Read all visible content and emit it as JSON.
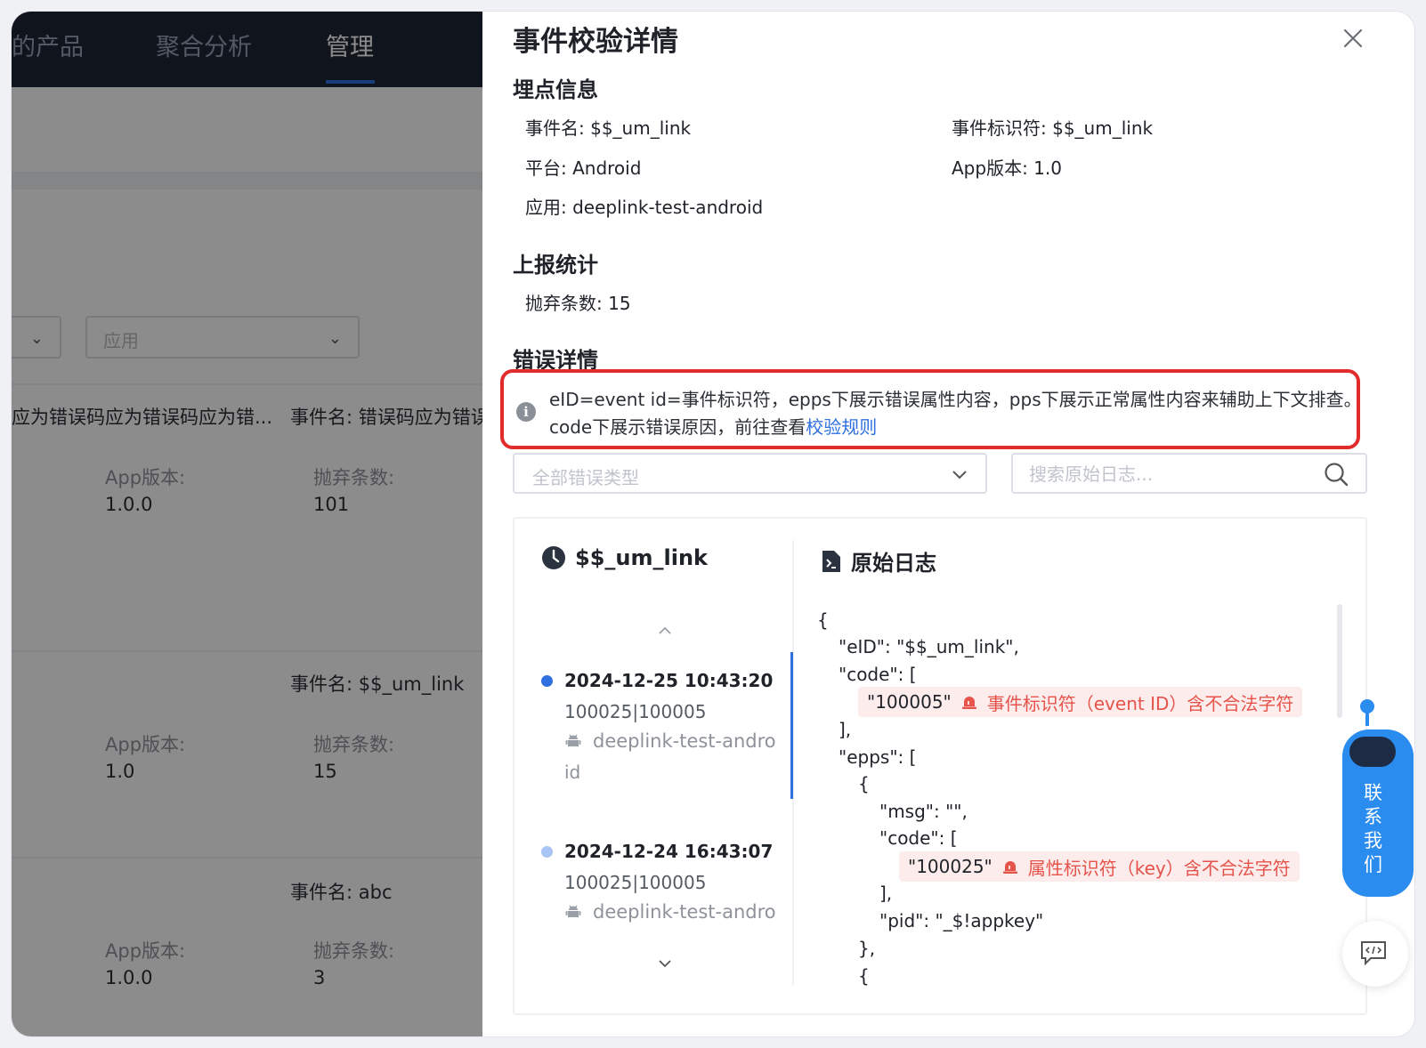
{
  "background": {
    "nav": {
      "items": [
        "的产品",
        "聚合分析",
        "管理"
      ],
      "active": 2
    },
    "filters": {
      "app_placeholder": "应用"
    },
    "cards": [
      {
        "left_text": "应为错误码应为错误码应为错...",
        "event_name": "事件名: 错误码应为错误",
        "app_version_label": "App版本:",
        "app_version": "1.0.0",
        "discard_label": "抛弃条数:",
        "discard": "101"
      },
      {
        "event_name": "事件名: $$_um_link",
        "app_version_label": "App版本:",
        "app_version": "1.0",
        "discard_label": "抛弃条数:",
        "discard": "15"
      },
      {
        "event_name": "事件名: abc",
        "app_version_label": "App版本:",
        "app_version": "1.0.0",
        "discard_label": "抛弃条数:",
        "discard": "3"
      }
    ]
  },
  "drawer": {
    "title": "事件校验详情",
    "sections": {
      "tracking": "埋点信息",
      "report": "上报统计",
      "errors": "错误详情"
    },
    "tracking_info": {
      "event_name": "事件名: $$_um_link",
      "event_id": "事件标识符: $$_um_link",
      "platform": "平台: Android",
      "app_version": "App版本: 1.0",
      "app": "应用: deeplink-test-android"
    },
    "report_stats": {
      "discard": "抛弃条数: 15"
    },
    "alert": {
      "line1": "eID=event id=事件标识符，epps下展示错误属性内容，pps下展示正常属性内容来辅助上下文排查。",
      "line2_prefix": "code下展示错误原因，前往查看",
      "link": "校验规则"
    },
    "filter": {
      "error_type_placeholder": "全部错误类型",
      "search_placeholder": "搜索原始日志..."
    },
    "events_panel": {
      "title": "$$_um_link",
      "items": [
        {
          "time": "2024-12-25 10:43:20",
          "codes": "100025|100005",
          "app": "deeplink-test-andro",
          "app_wrap": "id",
          "active": true
        },
        {
          "time": "2024-12-24 16:43:07",
          "codes": "100025|100005",
          "app": "deeplink-test-andro",
          "active": false
        }
      ]
    },
    "log_panel": {
      "title": "原始日志",
      "lines": {
        "open": "{",
        "eid": "\"eID\": \"$$_um_link\",",
        "code_open": "\"code\": [",
        "err1_val": "\"100005\"",
        "err1_msg": "事件标识符（event ID）含不合法字符",
        "code_close": "],",
        "epps_open": "\"epps\": [",
        "obj_open": "{",
        "msg": "\"msg\": \"\",",
        "code2_open": "\"code\": [",
        "err2_val": "\"100025\"",
        "err2_msg": "属性标识符（key）含不合法字符",
        "code2_close": "],",
        "pid": "\"pid\": \"_$!appkey\"",
        "obj_close": "},",
        "obj2_open": "{"
      }
    }
  },
  "widgets": {
    "contact_label": "联系我们"
  },
  "colors": {
    "accent": "#2f6fe0",
    "error": "#e5534b",
    "alert_border": "#e22b2b",
    "nav_bg": "#1c2536"
  }
}
